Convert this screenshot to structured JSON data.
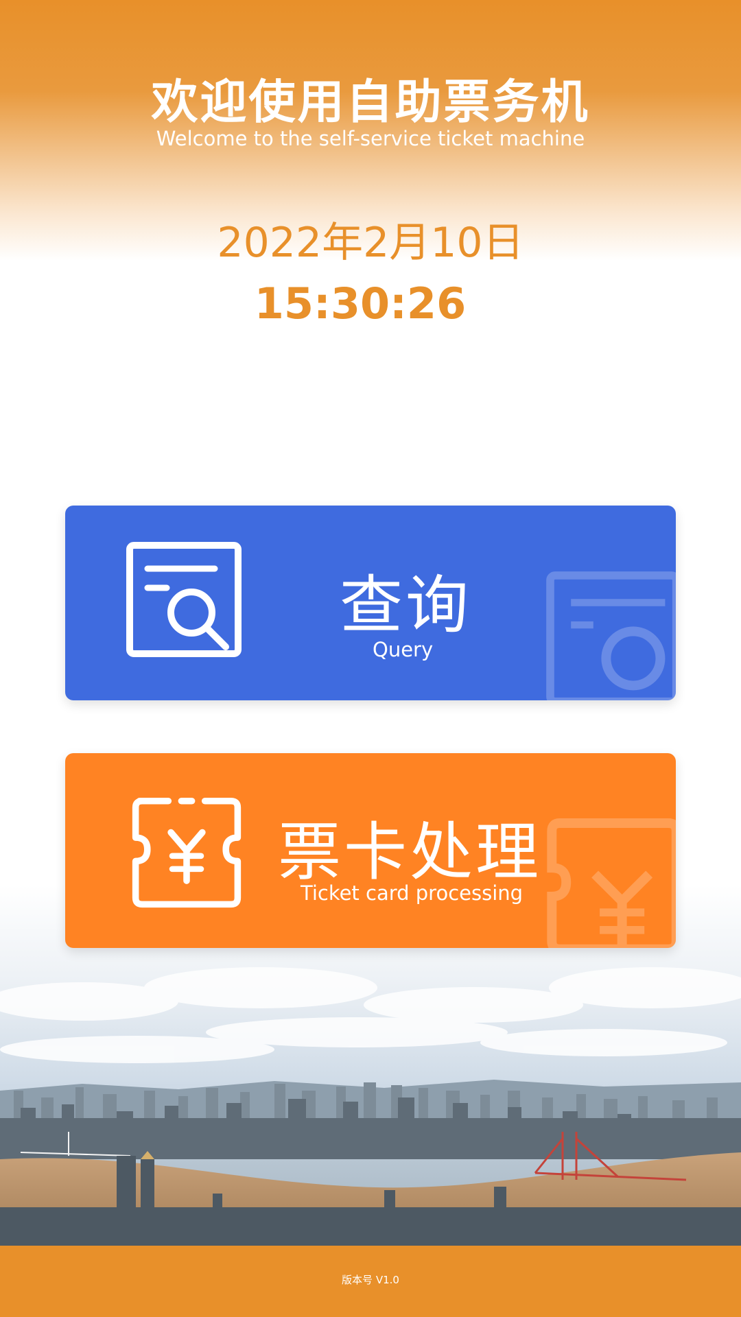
{
  "header": {
    "title": "欢迎使用自助票务机",
    "subtitle": "Welcome to the self-service ticket machine"
  },
  "clock": {
    "date": "2022年2月10日",
    "time": "15:30:26"
  },
  "actions": {
    "query": {
      "label_cn": "查询",
      "label_en": "Query",
      "icon": "search-document-icon",
      "color": "#3f6bdf"
    },
    "ticket": {
      "label_cn": "票卡处理",
      "label_en": "Ticket card processing",
      "icon": "yen-ticket-icon",
      "color": "#ff8323"
    }
  },
  "footer": {
    "version": "版本号 V1.0"
  },
  "colors": {
    "brand_orange": "#e8902a",
    "query_blue": "#3f6bdf",
    "ticket_orange": "#ff8323"
  }
}
